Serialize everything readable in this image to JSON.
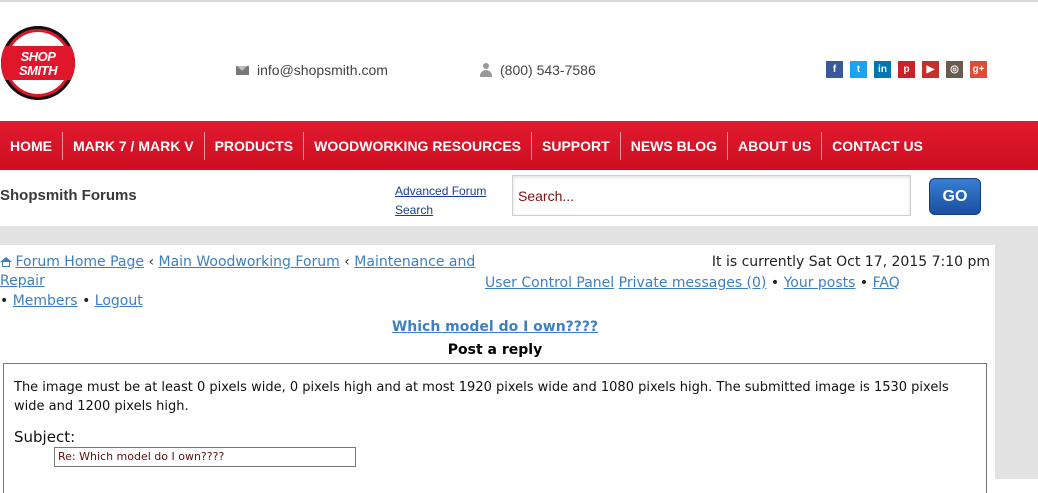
{
  "logo": {
    "line1": "SHOP",
    "line2": "SMITH"
  },
  "header": {
    "email": "info@shopsmith.com",
    "phone": "(800) 543-7586",
    "social": [
      {
        "name": "facebook",
        "glyph": "f",
        "color": "#3b5998"
      },
      {
        "name": "twitter",
        "glyph": "t",
        "color": "#1da1f2"
      },
      {
        "name": "linkedin",
        "glyph": "in",
        "color": "#0077b5"
      },
      {
        "name": "pinterest",
        "glyph": "p",
        "color": "#cb2027"
      },
      {
        "name": "youtube",
        "glyph": "▶",
        "color": "#c4302b"
      },
      {
        "name": "instagram",
        "glyph": "◎",
        "color": "#6b5a4e"
      },
      {
        "name": "googleplus",
        "glyph": "g+",
        "color": "#dd4b39"
      }
    ]
  },
  "nav": {
    "items": [
      {
        "label": "HOME"
      },
      {
        "label": "MARK 7 / MARK V"
      },
      {
        "label": "PRODUCTS"
      },
      {
        "label": "WOODWORKING RESOURCES"
      },
      {
        "label": "SUPPORT"
      },
      {
        "label": "NEWS BLOG"
      },
      {
        "label": "ABOUT US"
      },
      {
        "label": "CONTACT US"
      }
    ]
  },
  "forum_bar": {
    "title": "Shopsmith Forums",
    "advanced_search": "Advanced Forum Search",
    "search_value": "Search...",
    "go_label": "GO"
  },
  "breadcrumb": {
    "home": "Forum Home Page",
    "main": "Main Woodworking Forum",
    "sub": "Maintenance and Repair",
    "sep": "‹"
  },
  "status": {
    "time": "It is currently Sat Oct 17, 2015 7:10 pm",
    "ucp": "User Control Panel",
    "pm": "Private messages (0)",
    "posts": "Your posts",
    "faq": "FAQ",
    "members": "Members",
    "logout": "Logout",
    "bullet": "•"
  },
  "post": {
    "topic": "Which model do I own????",
    "heading": "Post a reply",
    "notice": "The image must be at least 0 pixels wide, 0 pixels high and at most 1920 pixels wide and 1080 pixels high. The submitted image is 1530 pixels wide and 1200 pixels high.",
    "subject_label": "Subject:",
    "subject_value": "Re: Which model do I own????"
  }
}
